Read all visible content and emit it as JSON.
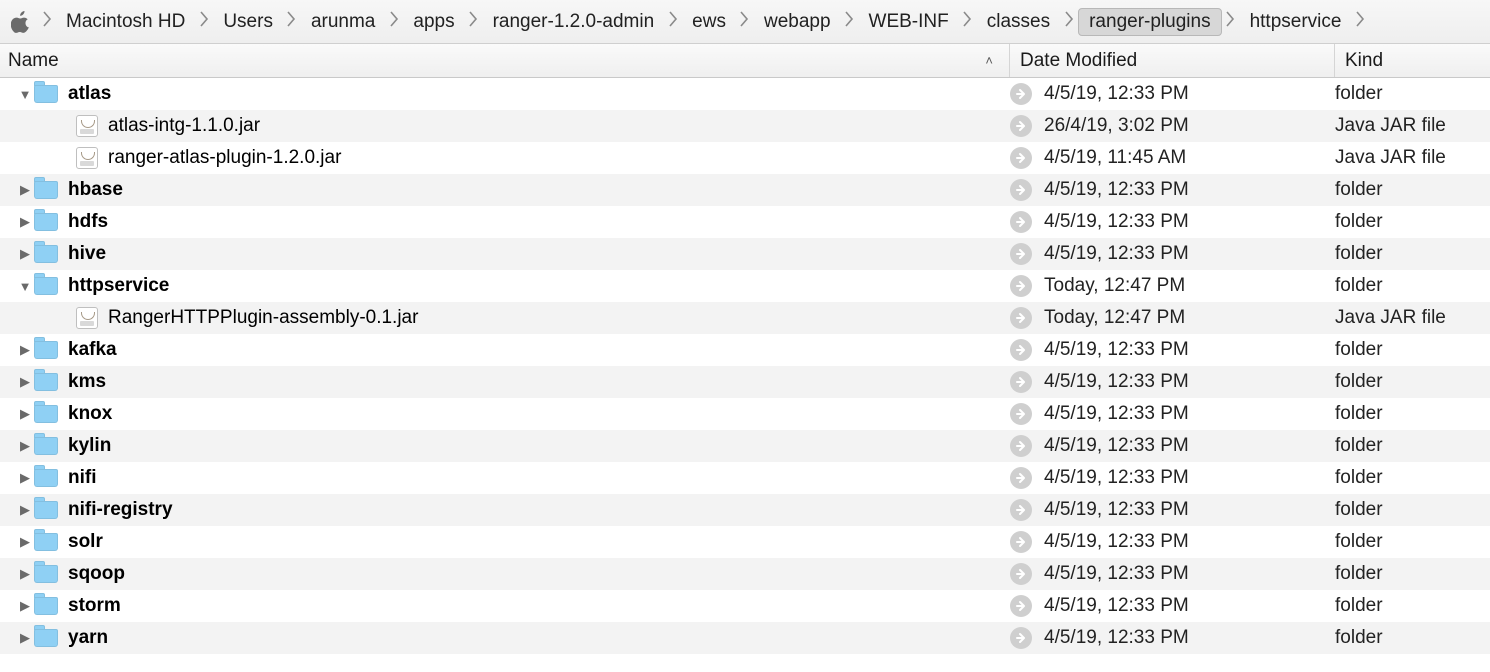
{
  "breadcrumb": [
    "Macintosh HD",
    "Users",
    "arunma",
    "apps",
    "ranger-1.2.0-admin",
    "ews",
    "webapp",
    "WEB-INF",
    "classes",
    "ranger-plugins",
    "httpservice"
  ],
  "breadcrumb_selected_index": 9,
  "columns": {
    "name": "Name",
    "date": "Date Modified",
    "kind": "Kind"
  },
  "kind_labels": {
    "folder": "folder",
    "jar": "Java JAR file"
  },
  "rows": [
    {
      "type": "folder",
      "name": "atlas",
      "indent": 0,
      "expanded": true,
      "date": "4/5/19, 12:33 PM",
      "kind": "folder"
    },
    {
      "type": "jar",
      "name": "atlas-intg-1.1.0.jar",
      "indent": 1,
      "date": "26/4/19, 3:02 PM",
      "kind": "jar"
    },
    {
      "type": "jar",
      "name": "ranger-atlas-plugin-1.2.0.jar",
      "indent": 1,
      "date": "4/5/19, 11:45 AM",
      "kind": "jar"
    },
    {
      "type": "folder",
      "name": "hbase",
      "indent": 0,
      "expanded": false,
      "date": "4/5/19, 12:33 PM",
      "kind": "folder"
    },
    {
      "type": "folder",
      "name": "hdfs",
      "indent": 0,
      "expanded": false,
      "date": "4/5/19, 12:33 PM",
      "kind": "folder"
    },
    {
      "type": "folder",
      "name": "hive",
      "indent": 0,
      "expanded": false,
      "date": "4/5/19, 12:33 PM",
      "kind": "folder"
    },
    {
      "type": "folder",
      "name": "httpservice",
      "indent": 0,
      "expanded": true,
      "date": "Today, 12:47 PM",
      "kind": "folder"
    },
    {
      "type": "jar",
      "name": "RangerHTTPPlugin-assembly-0.1.jar",
      "indent": 1,
      "date": "Today, 12:47 PM",
      "kind": "jar"
    },
    {
      "type": "folder",
      "name": "kafka",
      "indent": 0,
      "expanded": false,
      "date": "4/5/19, 12:33 PM",
      "kind": "folder"
    },
    {
      "type": "folder",
      "name": "kms",
      "indent": 0,
      "expanded": false,
      "date": "4/5/19, 12:33 PM",
      "kind": "folder"
    },
    {
      "type": "folder",
      "name": "knox",
      "indent": 0,
      "expanded": false,
      "date": "4/5/19, 12:33 PM",
      "kind": "folder"
    },
    {
      "type": "folder",
      "name": "kylin",
      "indent": 0,
      "expanded": false,
      "date": "4/5/19, 12:33 PM",
      "kind": "folder"
    },
    {
      "type": "folder",
      "name": "nifi",
      "indent": 0,
      "expanded": false,
      "date": "4/5/19, 12:33 PM",
      "kind": "folder"
    },
    {
      "type": "folder",
      "name": "nifi-registry",
      "indent": 0,
      "expanded": false,
      "date": "4/5/19, 12:33 PM",
      "kind": "folder"
    },
    {
      "type": "folder",
      "name": "solr",
      "indent": 0,
      "expanded": false,
      "date": "4/5/19, 12:33 PM",
      "kind": "folder"
    },
    {
      "type": "folder",
      "name": "sqoop",
      "indent": 0,
      "expanded": false,
      "date": "4/5/19, 12:33 PM",
      "kind": "folder"
    },
    {
      "type": "folder",
      "name": "storm",
      "indent": 0,
      "expanded": false,
      "date": "4/5/19, 12:33 PM",
      "kind": "folder"
    },
    {
      "type": "folder",
      "name": "yarn",
      "indent": 0,
      "expanded": false,
      "date": "4/5/19, 12:33 PM",
      "kind": "folder"
    }
  ]
}
